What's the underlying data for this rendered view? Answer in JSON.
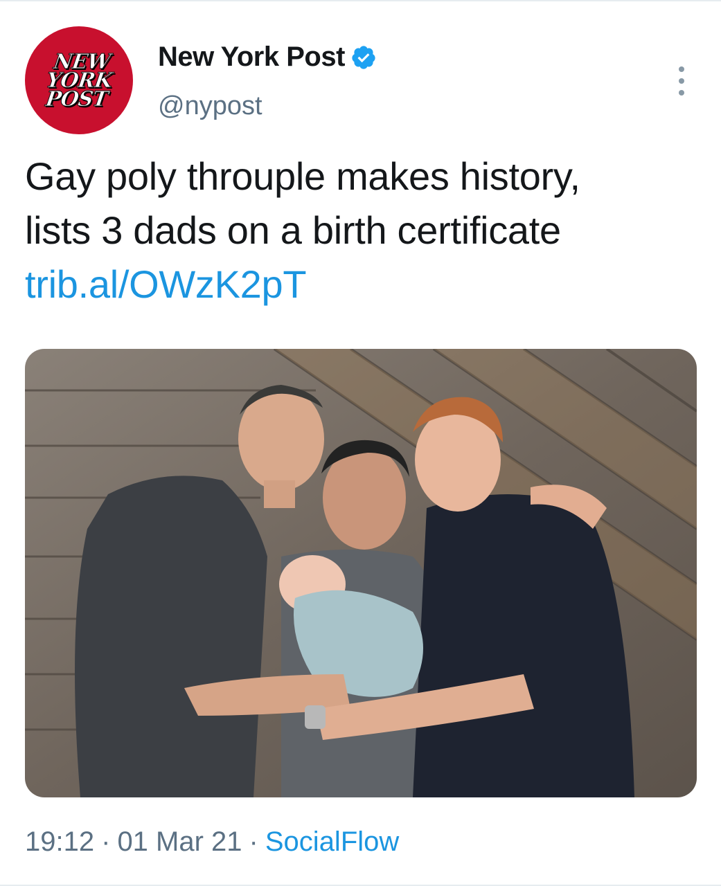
{
  "account": {
    "avatar_lines": [
      "NEW",
      "YORK",
      "POST"
    ],
    "display_name": "New York Post",
    "verified": true,
    "handle": "@nypost"
  },
  "tweet": {
    "text_line_1": "Gay poly throuple makes history,",
    "text_line_2": "lists 3 dads on a birth certificate",
    "link": "trib.al/OWzK2pT"
  },
  "meta": {
    "time": "19:12",
    "separator": "·",
    "date": "01 Mar 21",
    "source": "SocialFlow"
  },
  "icons": {
    "verified": "verified-badge-icon",
    "more": "more-vertical-icon"
  },
  "colors": {
    "brand_red": "#c8102e",
    "link_blue": "#1b95e0",
    "secondary_text": "#5b7083",
    "verified_blue": "#1da1f2"
  }
}
